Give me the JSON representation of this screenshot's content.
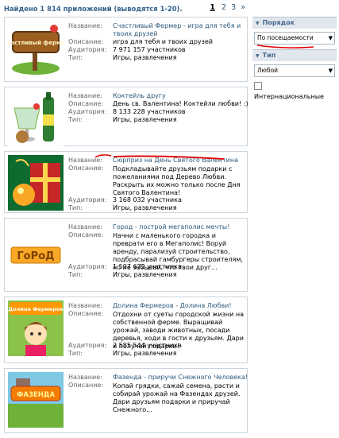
{
  "header": {
    "title": "Найдено 1 814 приложений (выводятся 1-20).",
    "pages": [
      "1",
      "2",
      "3"
    ],
    "next": "»"
  },
  "labels": {
    "name": "Название:",
    "description": "Описание:",
    "audience": "Аудитория:",
    "type": "Тип:"
  },
  "apps": [
    {
      "title": "Счастливый Фермер - игра для тебя и твоих друзей",
      "description": "игра для тебя и твоих друзей",
      "audience": "7 971 157 участников",
      "type": "Игры, развлечения",
      "logo": "Счастливый фермер"
    },
    {
      "title": "Коктейль другу",
      "description": "День св. Валентина! Коктейли любви! :)",
      "audience": "8 133 228 участников",
      "type": "Игры, развлечения",
      "logo": ""
    },
    {
      "title": "Сюрприз на День Святого Валентина",
      "description": "Подкладывайте друзьям подарки с пожеланиями под Дерево Любви. Раскрыть их можно только после Дня Святого Валентина!",
      "audience": "3 168 032 участника",
      "type": "Игры, развлечения",
      "logo": ""
    },
    {
      "title": "Город - построй мегаполис мечты!",
      "description": "Начни с маленького городка и преврати его в Мегаполис! Воруй аренду, парализуй строительство, подбрасывай гамбургеры строителям, но не забывай, что твои друг...",
      "audience": "1 597 672 участника",
      "type": "Игры, развлечения",
      "logo": "ГоРоД"
    },
    {
      "title": "Долина Фермеров - Долина Любви!",
      "description": "Отдохни от суеты городской жизни на собственной ферме. Выращивай урожай, заводи животных, посади деревья, ходи в гости к друзьям. Дари и получай подарки!",
      "audience": "2 585 544 участника",
      "type": "Игры, развлечения",
      "logo": "Долина Фермеров"
    },
    {
      "title": "Фазенда - приручи Снежного Человека!",
      "description": "Копай грядки, сажай семена, расти и собирай урожай на Фазендах друзей. Дари друзьям подарки и приручай Снежного...",
      "audience": "",
      "type": "",
      "logo": "ФАЗЕНДА"
    }
  ],
  "sidebar": {
    "order_heading": "Порядок",
    "order_value": "По посещаемости",
    "type_heading": "Тип",
    "type_value": "Любой",
    "international_label": "Интернациональные"
  }
}
